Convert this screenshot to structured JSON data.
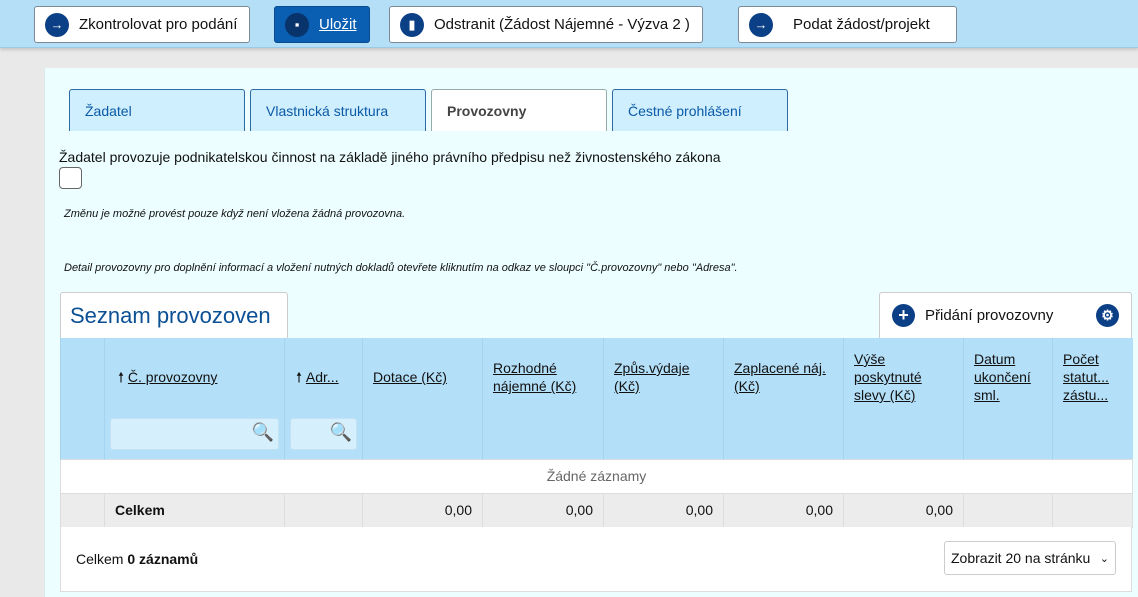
{
  "toolbar": {
    "check": "Zkontrolovat pro podání",
    "save": "Uložit",
    "delete": "Odstranit (Žádost Nájemné - Výzva 2 )",
    "submit": "Podat žádost/projekt"
  },
  "tabs": [
    "Žadatel",
    "Vlastnická struktura",
    "Provozovny",
    "Čestné prohlášení"
  ],
  "checkbox_label": "Žadatel provozuje podnikatelskou činnost na základě jiného právního předpisu než živnostenského zákona",
  "note1": "Změnu je možné provést pouze když není vložena žádná provozovna.",
  "note2": "Detail provozovny pro doplnění informací a vložení nutných dokladů otevřete kliknutím na odkaz ve sloupci \"Č.provozovny\" nebo \"Adresa\".",
  "list": {
    "title": "Seznam provozoven",
    "add": "Přidání provozovny"
  },
  "columns": [
    "Č. provozovny",
    "Adr...",
    "Dotace (Kč)",
    "Rozhodné nájemné (Kč)",
    "Způs.výdaje (Kč)",
    "Zaplacené náj. (Kč)",
    "Výše poskytnuté slevy (Kč)",
    "Datum ukončení sml.",
    "Počet statut... zástu..."
  ],
  "empty": "Žádné záznamy",
  "total": {
    "label": "Celkem",
    "values": [
      "0,00",
      "0,00",
      "0,00",
      "0,00",
      "0,00"
    ]
  },
  "footer": {
    "prefix": "Celkem",
    "count": "0 záznamů",
    "page_size": "Zobrazit 20 na stránku"
  }
}
